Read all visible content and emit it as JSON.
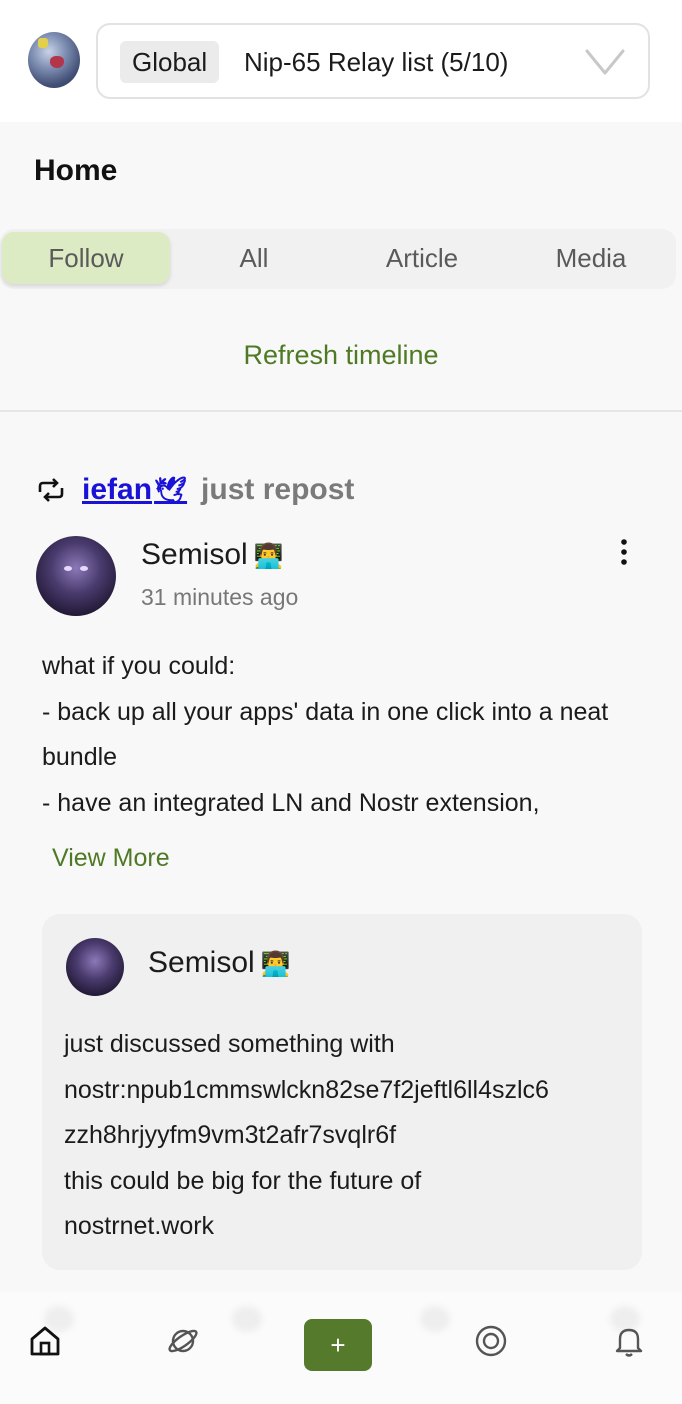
{
  "header": {
    "relay_scope": "Global",
    "relay_label": "Nip-65 Relay list (5/10)"
  },
  "page": {
    "title": "Home"
  },
  "tabs": [
    {
      "label": "Follow",
      "active": true
    },
    {
      "label": "All",
      "active": false
    },
    {
      "label": "Article",
      "active": false
    },
    {
      "label": "Media",
      "active": false
    }
  ],
  "timeline": {
    "refresh_label": "Refresh timeline"
  },
  "post": {
    "repost_user": "iefan",
    "repost_emoji": "🕊",
    "repost_text": "just repost",
    "author": "Semisol",
    "author_badge": "👨‍💻",
    "time": "31 minutes ago",
    "body": "what if you could:\n- back up all your apps' data in one click into a neat bundle\n- have an integrated LN and Nostr extension,",
    "view_more": "View More",
    "quote": {
      "author": "Semisol",
      "author_badge": "👨‍💻",
      "body": "just discussed something with\nnostr:npub1cmmswlckn82se7f2jeftl6ll4szlc6\nzzh8hrjyyfm9vm3t2afr7svqlr6f\nthis could be big for the future of\nnostrnet.work"
    }
  },
  "bottom_nav": {
    "compose_label": "+",
    "items": [
      "home-icon",
      "planet-icon",
      "compose",
      "target-icon",
      "bell-icon"
    ]
  },
  "colors": {
    "accent": "#4f7a25",
    "active_tab": "#dcebc3",
    "link": "#1a12d6",
    "compose": "#567a2c"
  }
}
